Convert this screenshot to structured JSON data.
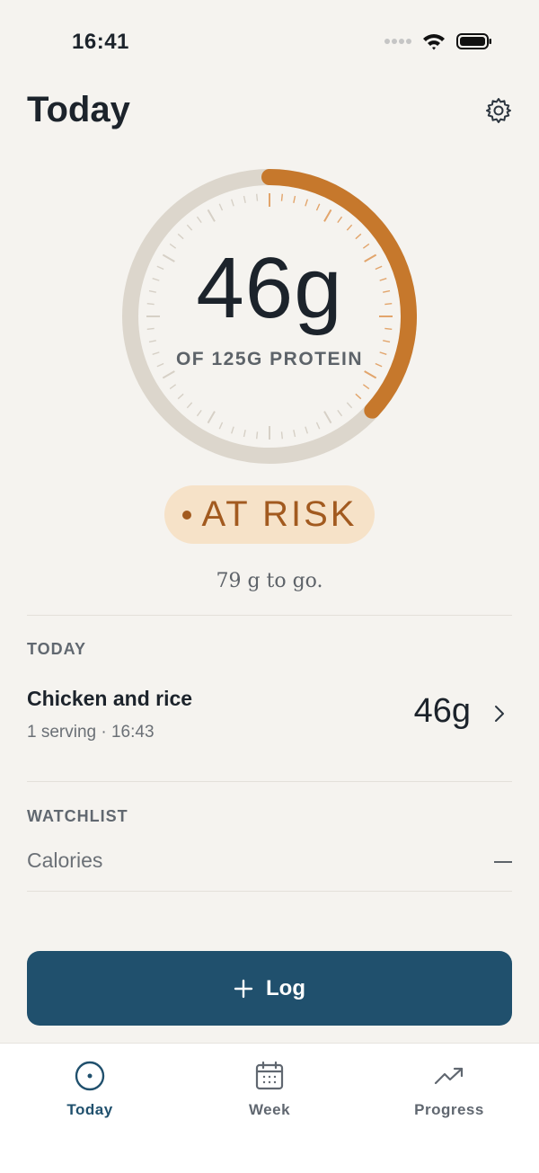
{
  "status_bar": {
    "time": "16:41"
  },
  "header": {
    "title": "Today"
  },
  "ring": {
    "value_text": "46g",
    "subtitle": "OF 125G PROTEIN",
    "current_g": 46,
    "goal_g": 125,
    "track_color": "#dcd6cc",
    "progress_color": "#c6782c"
  },
  "status": {
    "label": "AT RISK",
    "color": "#a25a1f",
    "bg": "#f6e2c8"
  },
  "remaining_text": "79 g to go.",
  "today_section": {
    "label": "TODAY",
    "entries": [
      {
        "name": "Chicken and rice",
        "meta": "1 serving · 16:43",
        "amount": "46g"
      }
    ]
  },
  "watchlist": {
    "label": "WATCHLIST",
    "items": [
      {
        "name": "Calories",
        "value": "—"
      }
    ]
  },
  "log_button": {
    "label": "Log",
    "color": "#20506d"
  },
  "tabs": [
    {
      "label": "Today",
      "icon": "target-icon",
      "active": true
    },
    {
      "label": "Week",
      "icon": "calendar-icon",
      "active": false
    },
    {
      "label": "Progress",
      "icon": "trend-icon",
      "active": false
    }
  ]
}
